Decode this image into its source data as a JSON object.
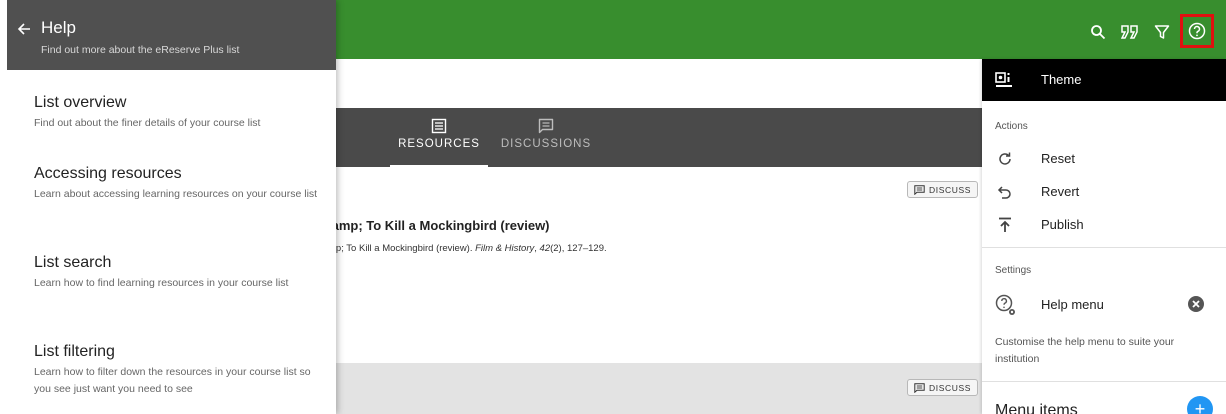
{
  "drawer": {
    "title": "Help",
    "subtitle": "Find out more about the eReserve Plus list",
    "items": [
      {
        "title": "List overview",
        "description": "Find out about the finer details of your course list"
      },
      {
        "title": "Accessing resources",
        "description": "Learn about accessing learning resources on your course list"
      },
      {
        "title": "List search",
        "description": "Learn how to find learning resources in your course list"
      },
      {
        "title": "List filtering",
        "description": "Learn how to filter down the resources in your course list so you see just want you need to see"
      }
    ]
  },
  "topbar": {
    "icons": [
      "search-icon",
      "quote-icon",
      "filter-icon",
      "help-icon"
    ],
    "accent": "#388e2e",
    "highlight": "#e01010"
  },
  "tabs": {
    "resources": "RESOURCES",
    "discussions": "DISCUSSIONS"
  },
  "list": {
    "discuss_label": "DISCUSS",
    "item_title": "/amp; To Kill a Mockingbird (review)",
    "item_citation_pre": "mp; To Kill a Mockingbird (review). ",
    "item_citation_journal": "Film & History",
    "item_citation_volume": "42",
    "item_citation_issue": "(2), 127–129."
  },
  "panel": {
    "title": "Theme",
    "actions_label": "Actions",
    "actions": [
      "Reset",
      "Revert",
      "Publish"
    ],
    "settings_label": "Settings",
    "help_menu_label": "Help menu",
    "customise_text": "Customise the help menu to suite your institution",
    "menu_items_label": "Menu items",
    "add_button": "+"
  }
}
